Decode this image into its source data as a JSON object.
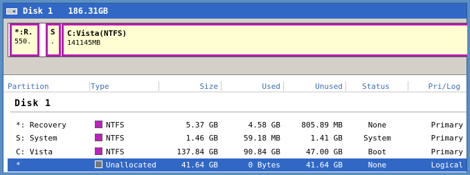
{
  "colors": {
    "ntfs": "#c21fc2",
    "unallocated": "#777777",
    "selection": "#3168c6"
  },
  "disk": {
    "name": "Disk 1",
    "size": "186.31GB",
    "icon": "hard-disk-icon"
  },
  "diskmap": [
    {
      "label": "*:R.",
      "sub": "550."
    },
    {
      "label": "S",
      "sub": "."
    },
    {
      "label": "C:Vista(NTFS)",
      "sub": "141145MB"
    }
  ],
  "columns": [
    "Partition",
    "Type",
    "Size",
    "Used",
    "Unused",
    "Status",
    "Pri/Log"
  ],
  "group": "Disk 1",
  "rows": [
    {
      "partition": "*: Recovery",
      "type": "NTFS",
      "size": "5.37 GB",
      "used": "4.58 GB",
      "unused": "805.89 MB",
      "status": "None",
      "prilog": "Primary"
    },
    {
      "partition": "S: System",
      "type": "NTFS",
      "size": "1.46 GB",
      "used": "59.18 MB",
      "unused": "1.41 GB",
      "status": "System",
      "prilog": "Primary"
    },
    {
      "partition": "C: Vista",
      "type": "NTFS",
      "size": "137.84 GB",
      "used": "90.84 GB",
      "unused": "47.00 GB",
      "status": "Boot",
      "prilog": "Primary"
    },
    {
      "partition": "*",
      "type": "Unallocated",
      "size": "41.64 GB",
      "used": "0 Bytes",
      "unused": "41.64 GB",
      "status": "None",
      "prilog": "Logical"
    }
  ]
}
